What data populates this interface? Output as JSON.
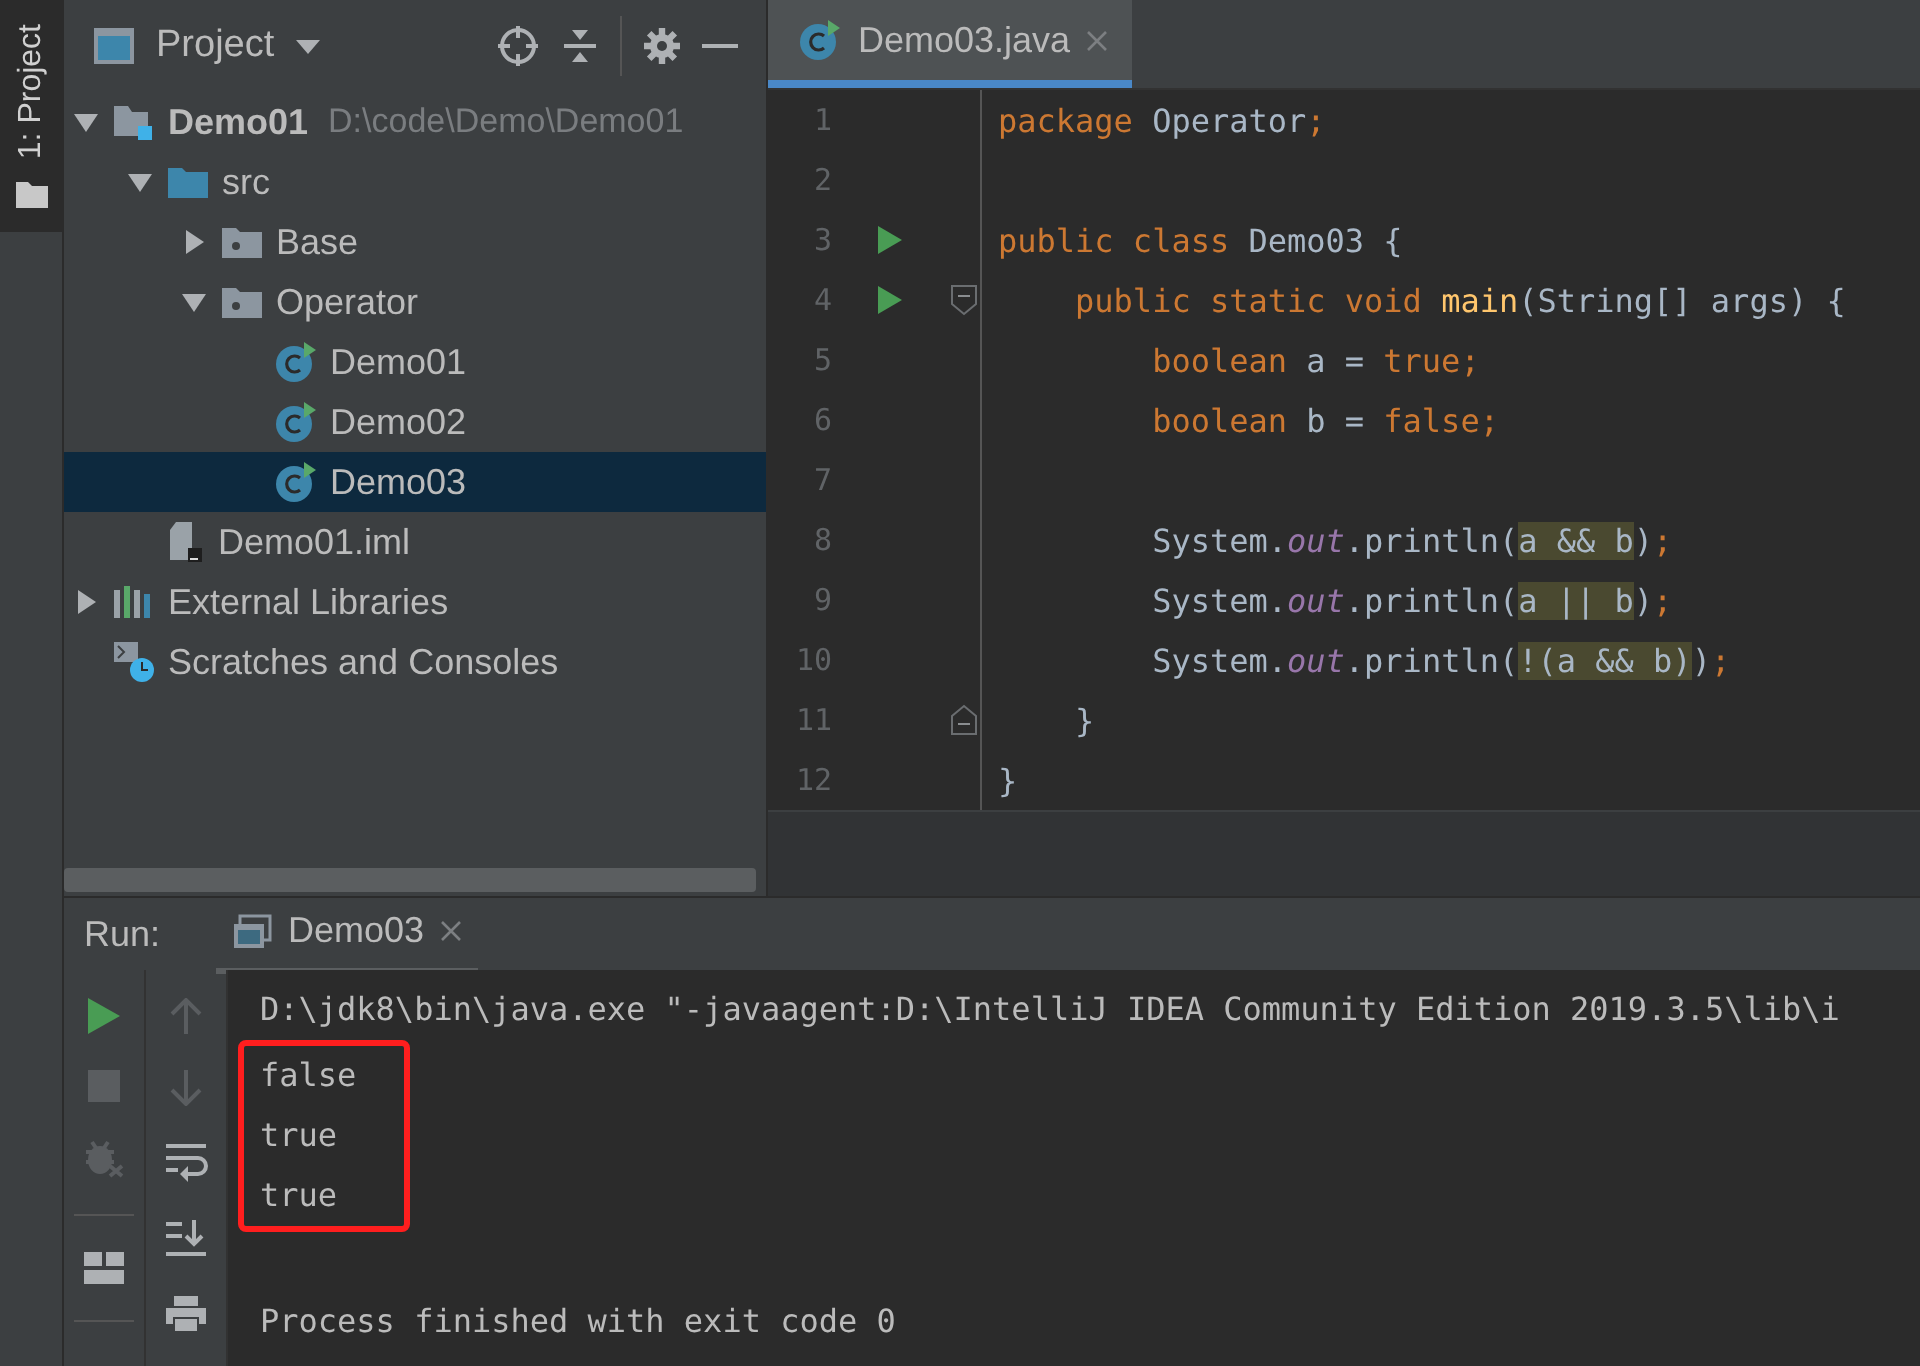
{
  "side_tabs": [
    {
      "label": "1: Project",
      "selected": true
    }
  ],
  "project_panel": {
    "title": "Project",
    "tree": [
      {
        "label": "Demo01",
        "hint": "D:\\code\\Demo\\Demo01",
        "kind": "module",
        "expanded": true,
        "selected": false,
        "children": [
          {
            "label": "src",
            "kind": "source-folder",
            "expanded": true,
            "selected": false,
            "children": [
              {
                "label": "Base",
                "kind": "package",
                "expanded": false,
                "selected": false
              },
              {
                "label": "Operator",
                "kind": "package",
                "expanded": true,
                "selected": false,
                "children": [
                  {
                    "label": "Demo01",
                    "kind": "class",
                    "selected": false
                  },
                  {
                    "label": "Demo02",
                    "kind": "class",
                    "selected": false
                  },
                  {
                    "label": "Demo03",
                    "kind": "class",
                    "selected": true
                  }
                ]
              }
            ]
          },
          {
            "label": "Demo01.iml",
            "kind": "module-file",
            "selected": false
          }
        ]
      },
      {
        "label": "External Libraries",
        "kind": "libraries",
        "expanded": false,
        "selected": false
      },
      {
        "label": "Scratches and Consoles",
        "kind": "scratches",
        "selected": false
      }
    ]
  },
  "editor": {
    "tabs": [
      {
        "label": "Demo03.java",
        "selected": true
      }
    ],
    "lines": [
      {
        "number": "1",
        "run": false,
        "kind": "code",
        "tokens": [
          {
            "kind": "keyword",
            "text": "package "
          },
          {
            "kind": "plain",
            "text": "Operator"
          },
          {
            "kind": "keyword",
            "text": ";"
          }
        ]
      },
      {
        "number": "2",
        "run": false,
        "kind": "code"
      },
      {
        "number": "3",
        "run": true,
        "kind": "code",
        "tokens": [
          {
            "kind": "keyword",
            "text": "public class "
          },
          {
            "kind": "plain",
            "text": "Demo03 {"
          }
        ]
      },
      {
        "number": "4",
        "run": true,
        "kind": "fold-start",
        "tokens": [
          {
            "kind": "keyword",
            "text": "    public static void "
          },
          {
            "kind": "method",
            "text": "main"
          },
          {
            "kind": "plain",
            "text": "(String[] args) {"
          }
        ]
      },
      {
        "number": "5",
        "run": false,
        "kind": "code",
        "tokens": [
          {
            "kind": "keyword",
            "text": "        boolean "
          },
          {
            "kind": "plain",
            "text": "a = "
          },
          {
            "kind": "keyword",
            "text": "true;"
          }
        ]
      },
      {
        "number": "6",
        "run": false,
        "kind": "code",
        "tokens": [
          {
            "kind": "keyword",
            "text": "        boolean "
          },
          {
            "kind": "plain",
            "text": "b = "
          },
          {
            "kind": "keyword",
            "text": "false;"
          }
        ]
      },
      {
        "number": "7",
        "run": false,
        "kind": "code"
      },
      {
        "number": "8",
        "run": false,
        "kind": "code",
        "tokens": [
          {
            "kind": "plain",
            "text": "        System."
          },
          {
            "kind": "field",
            "text": "out"
          },
          {
            "kind": "plain",
            "text": ".println("
          },
          {
            "kind": "match",
            "text": "a && b"
          },
          {
            "kind": "plain",
            "text": ")"
          },
          {
            "kind": "keyword",
            "text": ";"
          }
        ]
      },
      {
        "number": "9",
        "run": false,
        "kind": "code",
        "tokens": [
          {
            "kind": "plain",
            "text": "        System."
          },
          {
            "kind": "field",
            "text": "out"
          },
          {
            "kind": "plain",
            "text": ".println("
          },
          {
            "kind": "match",
            "text": "a || b"
          },
          {
            "kind": "plain",
            "text": ")"
          },
          {
            "kind": "keyword",
            "text": ";"
          }
        ]
      },
      {
        "number": "10",
        "run": false,
        "kind": "code",
        "tokens": [
          {
            "kind": "plain",
            "text": "        System."
          },
          {
            "kind": "field",
            "text": "out"
          },
          {
            "kind": "plain",
            "text": ".println("
          },
          {
            "kind": "match",
            "text": "!(a && b)"
          },
          {
            "kind": "plain",
            "text": ")"
          },
          {
            "kind": "keyword",
            "text": ";"
          }
        ]
      },
      {
        "number": "11",
        "run": false,
        "kind": "fold-end",
        "tokens": [
          {
            "kind": "plain",
            "text": "    }"
          }
        ]
      },
      {
        "number": "12",
        "run": false,
        "kind": "code",
        "tokens": [
          {
            "kind": "plain",
            "text": "}"
          }
        ]
      }
    ]
  },
  "run_panel": {
    "title": "Run:",
    "tabs": [
      {
        "label": "Demo03",
        "selected": true
      }
    ],
    "console": [
      {
        "kind": "command",
        "boxed": false,
        "text": "D:\\jdk8\\bin\\java.exe \"-javaagent:D:\\IntelliJ IDEA Community Edition 2019.3.5\\lib\\i"
      },
      {
        "kind": "output",
        "boxed": true,
        "text": "false"
      },
      {
        "kind": "output",
        "boxed": true,
        "text": "true"
      },
      {
        "kind": "output",
        "boxed": true,
        "text": "true"
      },
      {
        "kind": "exit",
        "boxed": false,
        "text": "Process finished with exit code 0"
      }
    ]
  }
}
